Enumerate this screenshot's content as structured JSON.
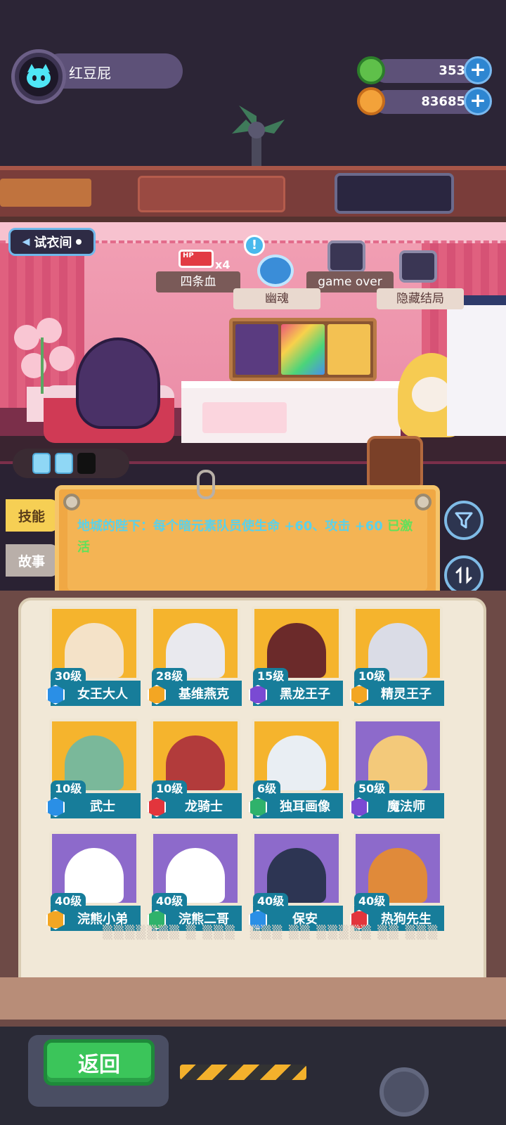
{
  "player": {
    "name": "红豆屁"
  },
  "currencies": [
    {
      "icon": "green-gem-icon",
      "value": "353"
    },
    {
      "icon": "gold-planet-coin-icon",
      "value": "83685"
    }
  ],
  "room": {
    "trial_button": "试衣间",
    "endings": [
      {
        "label": "四条血",
        "hp_multiplier": "x4",
        "hp_label": "HP"
      },
      {
        "label": "幽魂"
      },
      {
        "label": "game over"
      },
      {
        "label": "隐藏结局"
      }
    ],
    "energy": {
      "filled": 2,
      "total": 3
    }
  },
  "tabs": {
    "skill": "技能",
    "story": "故事"
  },
  "skill": {
    "text": "地城的陛下：每个暗元素队员使生命 +60、攻击 +60",
    "status": "已激活"
  },
  "roster": [
    {
      "level": "30级",
      "name": "女王大人",
      "element": "blue",
      "bg": "gold"
    },
    {
      "level": "28级",
      "name": "基维燕克",
      "element": "gold",
      "bg": "gold"
    },
    {
      "level": "15级",
      "name": "黑龙王子",
      "element": "purple",
      "bg": "gold"
    },
    {
      "level": "10级",
      "name": "精灵王子",
      "element": "gold",
      "bg": "gold"
    },
    {
      "level": "10级",
      "name": "武士",
      "element": "blue",
      "bg": "gold"
    },
    {
      "level": "10级",
      "name": "龙骑士",
      "element": "red",
      "bg": "gold"
    },
    {
      "level": "6级",
      "name": "独耳画像",
      "element": "green",
      "bg": "gold"
    },
    {
      "level": "50级",
      "name": "魔法师",
      "element": "purple",
      "bg": "purple"
    },
    {
      "level": "40级",
      "name": "浣熊小弟",
      "element": "gold",
      "bg": "purple"
    },
    {
      "level": "40级",
      "name": "浣熊二哥",
      "element": "green",
      "bg": "purple"
    },
    {
      "level": "40级",
      "name": "保安",
      "element": "blue",
      "bg": "purple"
    },
    {
      "level": "40级",
      "name": "热狗先生",
      "element": "red",
      "bg": "purple"
    }
  ],
  "bottom": {
    "back_label": "返回"
  },
  "colors": {
    "skill_text": "#5bd1e9",
    "active_text": "#63e05a",
    "namebar": "#177d9a",
    "back_button": "#3bc55a"
  }
}
